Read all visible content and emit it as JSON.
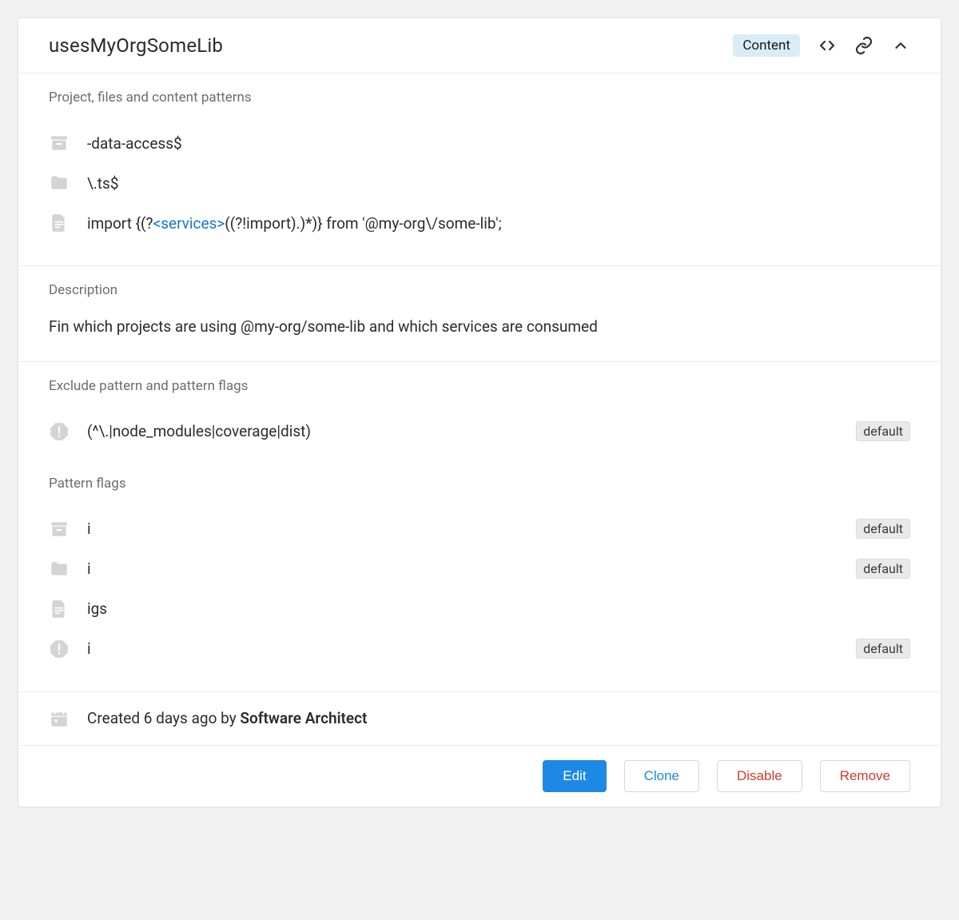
{
  "header": {
    "title": "usesMyOrgSomeLib",
    "content_pill": "Content"
  },
  "sections": {
    "patterns": {
      "label": "Project, files and content patterns",
      "project_pattern": "-data-access$",
      "file_pattern": "\\.ts$",
      "content_prefix": "import {(?",
      "content_highlight": "<services>",
      "content_suffix": "((?!import).)*)} from '@my-org\\/some-lib';"
    },
    "description": {
      "label": "Description",
      "text": "Fin which projects are using @my-org/some-lib and which services are consumed"
    },
    "exclude": {
      "label": "Exclude pattern and pattern flags",
      "pattern": "(^\\.|node_modules|coverage|dist)",
      "pattern_badge": "default",
      "flags_label": "Pattern flags",
      "flag_project": "i",
      "flag_project_badge": "default",
      "flag_file": "i",
      "flag_file_badge": "default",
      "flag_content": "igs",
      "flag_exclude": "i",
      "flag_exclude_badge": "default"
    }
  },
  "meta": {
    "created_prefix": "Created 6 days ago by ",
    "author": "Software Architect"
  },
  "footer": {
    "edit": "Edit",
    "clone": "Clone",
    "disable": "Disable",
    "remove": "Remove"
  }
}
